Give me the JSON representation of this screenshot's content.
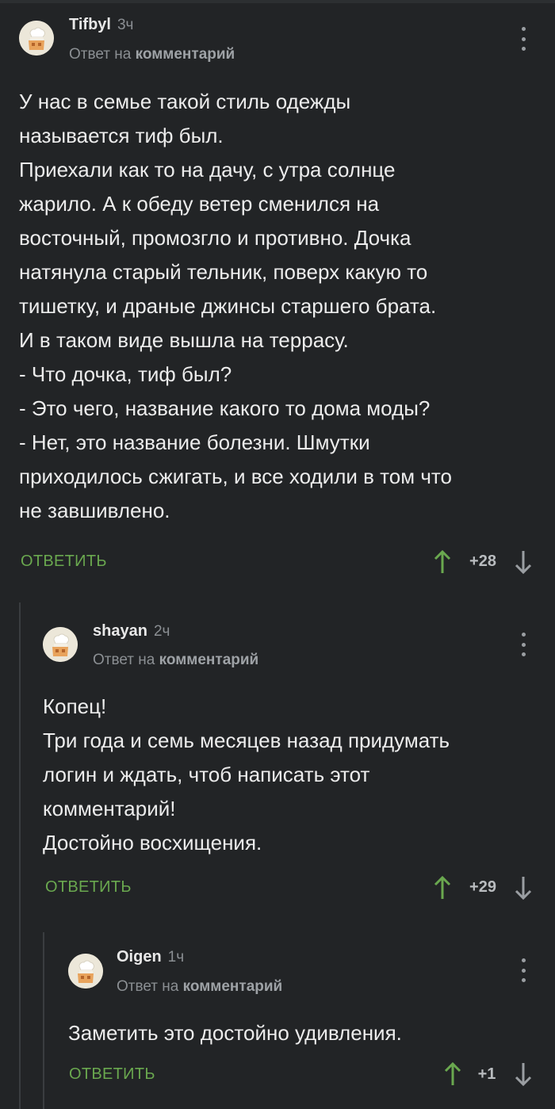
{
  "comments": [
    {
      "username": "Tifbyl",
      "time": "3ч",
      "reply_prefix": "Ответ на",
      "reply_target": "комментарий",
      "text": "У нас в семье такой стиль одежды\nназывается тиф был.\nПриехали как то на дачу, с утра солнце\nжарило. А к обеду ветер сменился на\nвосточный, промозгло и противно. Дочка\nнатянула старый тельник, поверх какую то\nтишетку, и драные джинсы старшего брата.\nИ в таком виде вышла на террасу.\n- Что дочка, тиф был?\n- Это чего, название какого то дома моды?\n- Нет, это название болезни. Шмутки\nприходилось сжигать, и все ходили в том что\nне завшивлено.",
      "reply_label": "ОТВЕТИТЬ",
      "rating": "+28"
    },
    {
      "username": "shayan",
      "time": "2ч",
      "reply_prefix": "Ответ на",
      "reply_target": "комментарий",
      "text": "Копец!\nТри года и семь месяцев назад придумать\nлогин и ждать, чтоб написать этот\nкомментарий!\nДостойно восхищения.",
      "reply_label": "ОТВЕТИТЬ",
      "rating": "+29"
    },
    {
      "username": "Oigen",
      "time": "1ч",
      "reply_prefix": "Ответ на",
      "reply_target": "комментарий",
      "text": "Заметить это достойно удивления.",
      "reply_label": "ОТВЕТИТЬ",
      "rating": "+1"
    }
  ],
  "colors": {
    "background": "#222426",
    "accent_green": "#6aa84f",
    "muted": "#8b8f93",
    "thread_line": "#3a3d40"
  },
  "icons": {
    "avatar": "chef-avatar-icon",
    "menu": "more-vertical-icon",
    "upvote": "arrow-up-icon",
    "downvote": "arrow-down-icon"
  }
}
